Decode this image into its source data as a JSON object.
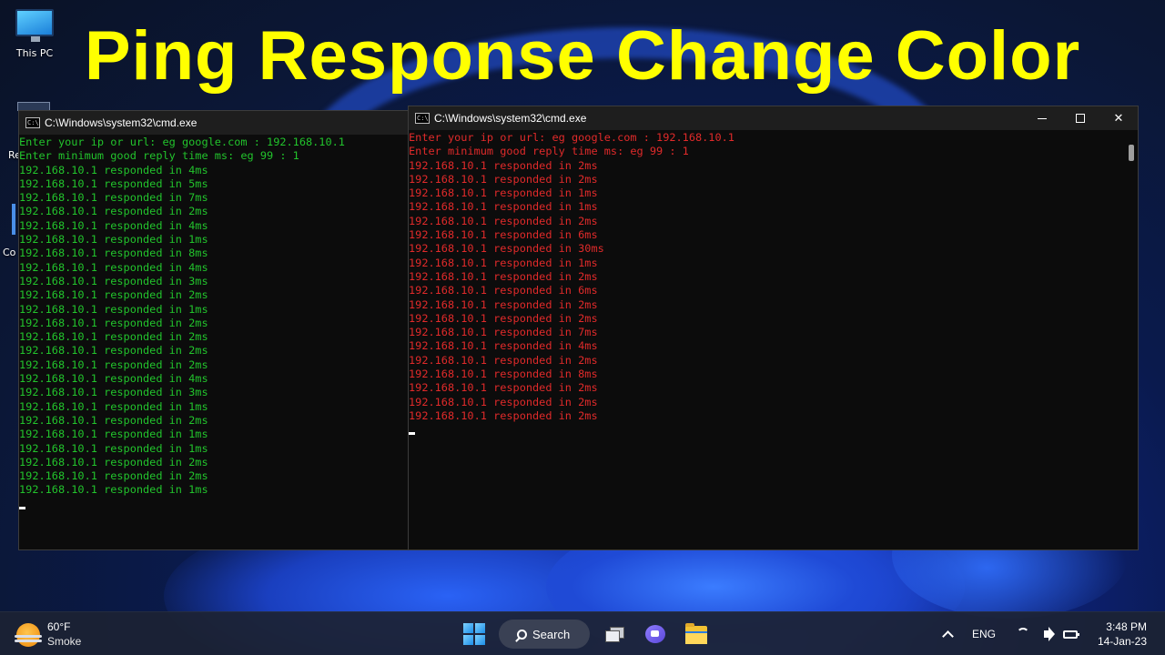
{
  "headline": "Ping Response Change Color",
  "desktop": {
    "icons": [
      {
        "label": "This PC"
      }
    ],
    "fragments": [
      "Re",
      "Co"
    ]
  },
  "colors": {
    "headline": "#ffff00",
    "good_text": "#22c32c",
    "bad_text": "#e02a2a",
    "console_bg": "#0c0c0c"
  },
  "windows": {
    "left": {
      "title": "C:\\Windows\\system32\\cmd.exe",
      "lines": [
        "Enter your ip or url: eg google.com : 192.168.10.1",
        "Enter minimum good reply time ms: eg 99 : 1",
        "192.168.10.1 responded in 4ms",
        "192.168.10.1 responded in 5ms",
        "192.168.10.1 responded in 7ms",
        "192.168.10.1 responded in 2ms",
        "192.168.10.1 responded in 4ms",
        "192.168.10.1 responded in 1ms",
        "192.168.10.1 responded in 8ms",
        "192.168.10.1 responded in 4ms",
        "192.168.10.1 responded in 3ms",
        "192.168.10.1 responded in 2ms",
        "192.168.10.1 responded in 1ms",
        "192.168.10.1 responded in 2ms",
        "192.168.10.1 responded in 2ms",
        "192.168.10.1 responded in 2ms",
        "192.168.10.1 responded in 2ms",
        "192.168.10.1 responded in 4ms",
        "192.168.10.1 responded in 3ms",
        "192.168.10.1 responded in 1ms",
        "192.168.10.1 responded in 2ms",
        "192.168.10.1 responded in 1ms",
        "192.168.10.1 responded in 1ms",
        "192.168.10.1 responded in 2ms",
        "192.168.10.1 responded in 2ms",
        "192.168.10.1 responded in 1ms"
      ]
    },
    "right": {
      "title": "C:\\Windows\\system32\\cmd.exe",
      "lines": [
        "Enter your ip or url: eg google.com : 192.168.10.1",
        "Enter minimum good reply time ms: eg 99 : 1",
        "192.168.10.1 responded in 2ms",
        "192.168.10.1 responded in 2ms",
        "192.168.10.1 responded in 1ms",
        "192.168.10.1 responded in 1ms",
        "192.168.10.1 responded in 2ms",
        "192.168.10.1 responded in 6ms",
        "192.168.10.1 responded in 30ms",
        "192.168.10.1 responded in 1ms",
        "192.168.10.1 responded in 2ms",
        "192.168.10.1 responded in 6ms",
        "192.168.10.1 responded in 2ms",
        "192.168.10.1 responded in 2ms",
        "192.168.10.1 responded in 7ms",
        "192.168.10.1 responded in 4ms",
        "192.168.10.1 responded in 2ms",
        "192.168.10.1 responded in 8ms",
        "192.168.10.1 responded in 2ms",
        "192.168.10.1 responded in 2ms",
        "192.168.10.1 responded in 2ms"
      ],
      "controls": [
        "minimize-icon",
        "maximize-icon",
        "close-icon"
      ],
      "close_glyph": "✕"
    }
  },
  "taskbar": {
    "weather": {
      "temp": "60°F",
      "condition": "Smoke"
    },
    "search_label": "Search",
    "apps": [
      "start-icon",
      "search-icon",
      "task-view-icon",
      "chat-icon",
      "file-explorer-icon"
    ],
    "tray": {
      "language": "ENG",
      "time": "3:48 PM",
      "date": "14-Jan-23"
    }
  }
}
